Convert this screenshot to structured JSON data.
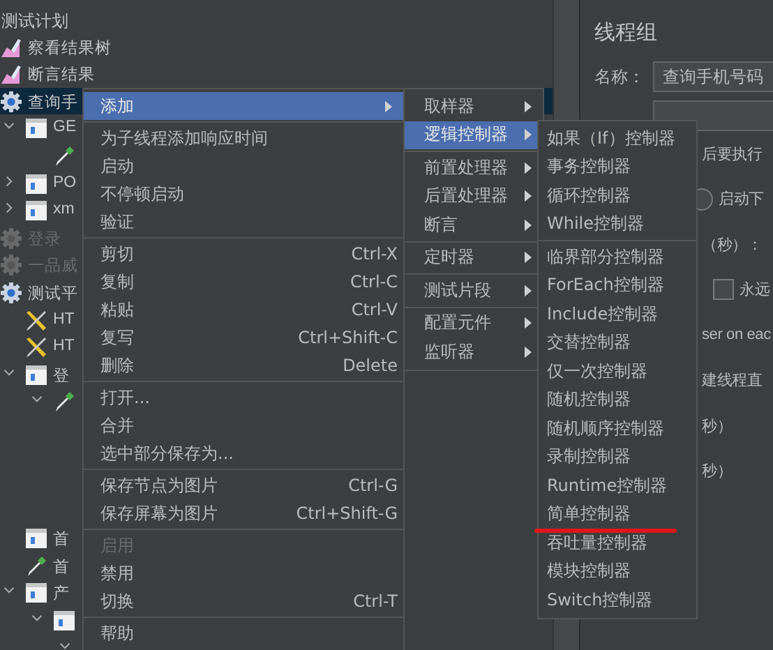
{
  "tree": {
    "root": {
      "label": "测试计划",
      "children": [
        {
          "label": "察看结果树",
          "kind": "listener"
        },
        {
          "label": "断言结果",
          "kind": "listener"
        },
        {
          "label": "查询手",
          "kind": "threadgroup",
          "selected": true,
          "disabled": false,
          "children": [
            {
              "label": "GE",
              "kind": "sampler",
              "expanded": true,
              "children": [
                {
                  "kind": "extractor"
                }
              ]
            },
            {
              "label": "PO",
              "kind": "sampler",
              "expanded": false
            },
            {
              "label": "xm",
              "kind": "sampler",
              "expanded": false
            }
          ]
        },
        {
          "label": "登录",
          "kind": "threadgroup",
          "selected": false,
          "disabled": true
        },
        {
          "label": "一品威",
          "kind": "threadgroup",
          "selected": false,
          "disabled": true
        },
        {
          "label": "测试平",
          "kind": "threadgroup",
          "selected": false,
          "disabled": false,
          "children": [
            {
              "label": "HT",
              "kind": "config"
            },
            {
              "label": "HT",
              "kind": "config"
            },
            {
              "label": "登",
              "kind": "sampler",
              "expanded": true,
              "children": [
                {
                  "kind": "extractor",
                  "expanded": true
                }
              ]
            },
            {
              "label": "首",
              "kind": "sampler"
            },
            {
              "label": "首",
              "kind": "extractor"
            },
            {
              "label": "产",
              "kind": "sampler",
              "expanded": true,
              "children": [
                {
                  "kind": "sampler",
                  "expanded": true,
                  "children": [
                    {
                      "expanded": true
                    }
                  ]
                }
              ]
            }
          ]
        }
      ]
    }
  },
  "panel": {
    "title": "线程组",
    "name_label": "名称：",
    "name_value": "查询手机号码",
    "sections": [
      [
        {
          "kind": "text",
          "text": "后要执行"
        },
        {
          "kind": "radio",
          "text": "启动下",
          "checked": false
        }
      ],
      [
        {
          "kind": "text",
          "text": "（秒）："
        },
        {
          "kind": "checkbox",
          "text": "永远",
          "checked": false
        },
        {
          "kind": "text",
          "text": "ser on eac"
        },
        {
          "kind": "text",
          "text": "建线程直"
        }
      ],
      [
        {
          "kind": "text",
          "text": "秒）"
        },
        {
          "kind": "text",
          "text": "秒）"
        }
      ]
    ]
  },
  "context_menu": {
    "groups": [
      [
        {
          "label": "添加",
          "submenu": true,
          "selected": true
        }
      ],
      [
        {
          "label": "为子线程添加响应时间"
        },
        {
          "label": "启动"
        },
        {
          "label": "不停顿启动"
        },
        {
          "label": "验证"
        }
      ],
      [
        {
          "label": "剪切",
          "shortcut": "Ctrl-X"
        },
        {
          "label": "复制",
          "shortcut": "Ctrl-C"
        },
        {
          "label": "粘贴",
          "shortcut": "Ctrl-V"
        },
        {
          "label": "复写",
          "shortcut": "Ctrl+Shift-C"
        },
        {
          "label": "删除",
          "shortcut": "Delete"
        }
      ],
      [
        {
          "label": "打开..."
        },
        {
          "label": "合并"
        },
        {
          "label": "选中部分保存为..."
        }
      ],
      [
        {
          "label": "保存节点为图片",
          "shortcut": "Ctrl-G"
        },
        {
          "label": "保存屏幕为图片",
          "shortcut": "Ctrl+Shift-G"
        }
      ],
      [
        {
          "label": "启用",
          "disabled": true
        },
        {
          "label": "禁用"
        },
        {
          "label": "切换",
          "shortcut": "Ctrl-T"
        }
      ],
      [
        {
          "label": "帮助"
        }
      ]
    ]
  },
  "add_submenu": {
    "groups": [
      [
        {
          "label": "取样器",
          "submenu": true,
          "selected": false
        },
        {
          "label": "逻辑控制器",
          "submenu": true,
          "selected": true
        }
      ],
      [
        {
          "label": "前置处理器",
          "submenu": true,
          "selected": false
        },
        {
          "label": "后置处理器",
          "submenu": true,
          "selected": false
        },
        {
          "label": "断言",
          "submenu": true,
          "selected": false
        }
      ],
      [
        {
          "label": "定时器",
          "submenu": true,
          "selected": false
        }
      ],
      [
        {
          "label": "测试片段",
          "submenu": true,
          "selected": false
        }
      ],
      [
        {
          "label": "配置元件",
          "submenu": true,
          "selected": false
        },
        {
          "label": "监听器",
          "submenu": true,
          "selected": false
        }
      ]
    ]
  },
  "logic_controller_submenu": {
    "groups": [
      [
        {
          "label": "如果（If）控制器",
          "underlined": false
        },
        {
          "label": "事务控制器",
          "underlined": false
        },
        {
          "label": "循环控制器",
          "underlined": false
        },
        {
          "label": "While控制器",
          "underlined": false
        }
      ],
      [
        {
          "label": "临界部分控制器",
          "underlined": false
        },
        {
          "label": "ForEach控制器",
          "underlined": false
        },
        {
          "label": "Include控制器",
          "underlined": false
        },
        {
          "label": "交替控制器",
          "underlined": false
        },
        {
          "label": "仅一次控制器",
          "underlined": false
        },
        {
          "label": "随机控制器",
          "underlined": false
        },
        {
          "label": "随机顺序控制器",
          "underlined": false
        },
        {
          "label": "录制控制器",
          "underlined": false
        },
        {
          "label": "Runtime控制器",
          "underlined": false
        },
        {
          "label": "简单控制器",
          "underlined": true
        },
        {
          "label": "吞吐量控制器",
          "underlined": false
        },
        {
          "label": "模块控制器",
          "underlined": false
        },
        {
          "label": "Switch控制器",
          "underlined": false
        }
      ]
    ]
  }
}
